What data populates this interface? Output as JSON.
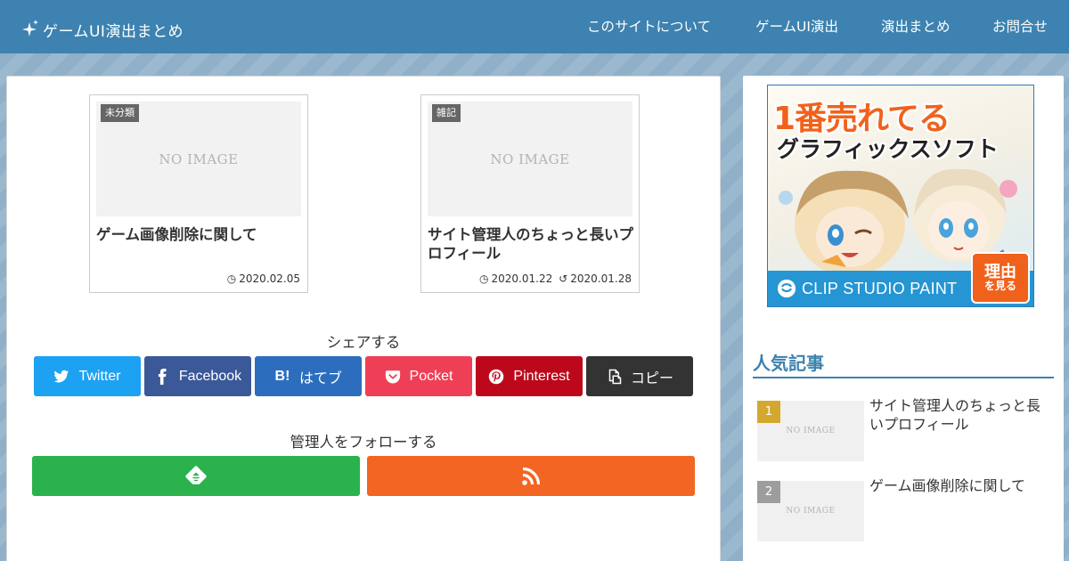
{
  "header": {
    "site_title": "ゲームUI演出まとめ",
    "nav": [
      "このサイトについて",
      "ゲームUI演出",
      "演出まとめ",
      "お問合せ"
    ],
    "bg_color": "#3d82b0"
  },
  "posts": [
    {
      "category": "未分類",
      "thumb_text": "NO IMAGE",
      "title": "ゲーム画像削除に関して",
      "published": "2020.02.05",
      "updated": ""
    },
    {
      "category": "雑記",
      "thumb_text": "NO IMAGE",
      "title": "サイト管理人のちょっと長いプロフィール",
      "published": "2020.01.22",
      "updated": "2020.01.28"
    }
  ],
  "share": {
    "heading": "シェアする",
    "buttons": [
      {
        "label": "Twitter",
        "icon": "twitter-icon",
        "color": "#1da1f2"
      },
      {
        "label": "Facebook",
        "icon": "facebook-icon",
        "color": "#3b5998"
      },
      {
        "label": "はてブ",
        "icon": "hatena-bookmark-icon",
        "color": "#2c6ebd"
      },
      {
        "label": "Pocket",
        "icon": "pocket-icon",
        "color": "#ef3f56"
      },
      {
        "label": "Pinterest",
        "icon": "pinterest-icon",
        "color": "#bd081c"
      },
      {
        "label": "コピー",
        "icon": "copy-icon",
        "color": "#333333"
      }
    ]
  },
  "follow": {
    "heading": "管理人をフォローする",
    "buttons": [
      {
        "icon": "feedly-icon",
        "color": "#2bb24c"
      },
      {
        "icon": "rss-icon",
        "color": "#f26522"
      }
    ]
  },
  "sidebar": {
    "ad": {
      "headline": "1番売れてる",
      "subline": "グラフィックスソフト",
      "brand": "CLIP STUDIO PAINT",
      "cta_line1": "理由",
      "cta_line2": "を見る"
    },
    "popular": {
      "heading": "人気記事",
      "items": [
        {
          "rank": "1",
          "thumb_text": "NO IMAGE",
          "title": "サイト管理人のちょっと長いプロフィール"
        },
        {
          "rank": "2",
          "thumb_text": "NO IMAGE",
          "title": "ゲーム画像削除に関して"
        }
      ]
    }
  }
}
